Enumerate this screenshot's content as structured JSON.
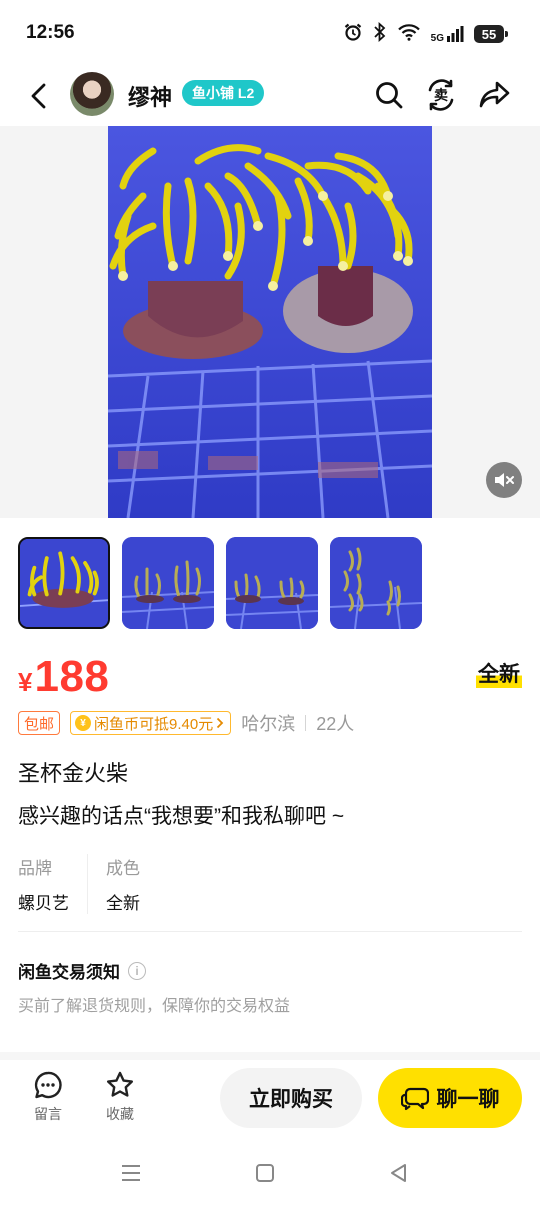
{
  "status_bar": {
    "time": "12:56",
    "battery": "55",
    "network": "5G"
  },
  "header": {
    "seller_name": "缪神",
    "shop_badge": "鱼小铺 L2",
    "icons": [
      "back-icon",
      "search-icon",
      "sell-icon",
      "share-icon"
    ],
    "sell_icon_glyph": "卖"
  },
  "media": {
    "mute_icon": "mute-icon",
    "thumbnail_count": 4,
    "active_thumbnail": 1
  },
  "product": {
    "currency": "¥",
    "price": "188",
    "condition": "全新",
    "shipping_tag": "包邮",
    "coin_tag": "闲鱼币可抵9.40元",
    "location": "哈尔滨",
    "wants": "22人",
    "title": "圣杯金火柴",
    "description": "感兴趣的话点“我想要”和我私聊吧 ~"
  },
  "attributes": [
    {
      "label": "品牌",
      "value": "螺贝艺"
    },
    {
      "label": "成色",
      "value": "全新"
    }
  ],
  "notice": {
    "title": "闲鱼交易须知",
    "subtitle": "买前了解退货规则，保障你的交易权益"
  },
  "actions": {
    "comment_label": "留言",
    "favorite_label": "收藏",
    "buy_label": "立即购买",
    "chat_label": "聊一聊"
  },
  "colors": {
    "price": "#ff3b30",
    "accent_yellow": "#ffe000",
    "shop_badge": "#1fc7c9"
  }
}
